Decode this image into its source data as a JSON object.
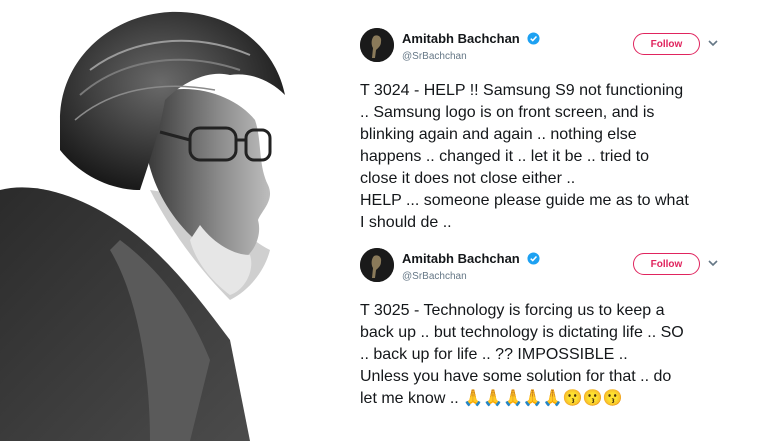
{
  "colors": {
    "follow_accent": "#e0245e",
    "verified_blue": "#1da1f2",
    "text_primary": "#14171a",
    "text_secondary": "#657786"
  },
  "tweets": [
    {
      "display_name": "Amitabh Bachchan",
      "handle": "@SrBachchan",
      "verified": true,
      "follow_label": "Follow",
      "menu_icon": "chevron-down-icon",
      "text": "T 3024 - HELP !! Samsung S9  not functioning\n.. Samsung logo is on front screen, and is\nblinking again and again .. nothing else\nhappens .. changed it .. let it be .. tried to\nclose it does not close either ..\nHELP ... someone please guide me as to what\nI should de .."
    },
    {
      "display_name": "Amitabh Bachchan",
      "handle": "@SrBachchan",
      "verified": true,
      "follow_label": "Follow",
      "menu_icon": "chevron-down-icon",
      "text": "T 3025 - Technology is forcing us to keep a\nback up .. but technology is dictating life .. SO\n.. back up for life .. ??  IMPOSSIBLE ..\nUnless you have some solution for that .. do\nlet me know .. 🙏🙏🙏🙏🙏😗😗😗"
    }
  ]
}
